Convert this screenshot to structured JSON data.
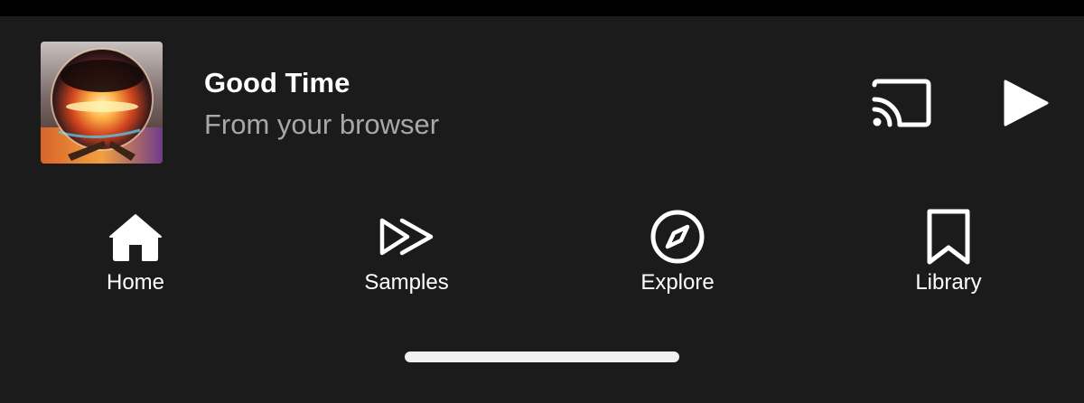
{
  "mini_player": {
    "title": "Good Time",
    "subtitle": "From your browser",
    "album_art_icon": "album-art-crystal-ball",
    "cast_icon": "cast-icon",
    "play_icon": "play-icon"
  },
  "bottom_nav": {
    "items": [
      {
        "label": "Home",
        "icon": "home-icon"
      },
      {
        "label": "Samples",
        "icon": "samples-icon"
      },
      {
        "label": "Explore",
        "icon": "compass-icon"
      },
      {
        "label": "Library",
        "icon": "bookmark-icon"
      }
    ]
  },
  "colors": {
    "background": "#1b1b1b",
    "primary_text": "#ffffff",
    "secondary_text": "#a8a8a8",
    "home_indicator": "#f0f0f0"
  }
}
